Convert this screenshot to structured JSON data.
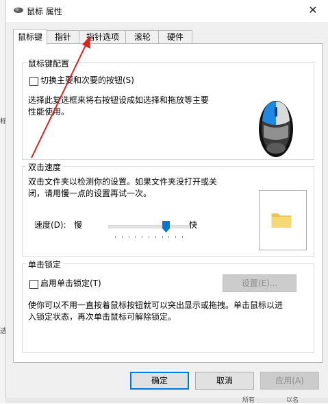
{
  "window": {
    "title": "鼠标 属性",
    "close": "✕"
  },
  "tabs": [
    {
      "label": "鼠标键"
    },
    {
      "label": "指针"
    },
    {
      "label": "指针选项"
    },
    {
      "label": "滚轮"
    },
    {
      "label": "硬件"
    }
  ],
  "button_config": {
    "title": "鼠标键配置",
    "checkbox_label": "切换主要和次要的按钮(S)",
    "description": [
      "选择此复选框来将右按钮设成如选择和拖放等主要",
      "性能使用。"
    ]
  },
  "double_click": {
    "title": "双击速度",
    "description": [
      "双击文件夹以检测你的设置。如果文件夹没打开或关",
      "闭，请用慢一点的设置再试一次。"
    ],
    "speed_label": "速度(D):",
    "slow_label": "慢",
    "fast_label": "快",
    "speed_level": 0.75
  },
  "click_lock": {
    "title": "单击锁定",
    "checkbox_label": "启用单击锁定(T)",
    "settings_button": "设置(E)...",
    "description": [
      "使你可以不用一直按着鼠标按钮就可以突出显示或拖拽。单击鼠标以进",
      "入锁定状态，再次单击鼠标可解除锁定。"
    ]
  },
  "footer": {
    "ok": "确定",
    "cancel": "取消",
    "apply": "应用(A)"
  },
  "left_edge": [
    "标",
    "选"
  ],
  "bottom_edge": [
    "所有",
    "以名"
  ],
  "colors": {
    "accent": "#0078d7",
    "arrow": "#e02020",
    "mouse_blue": "#1e88e5"
  }
}
